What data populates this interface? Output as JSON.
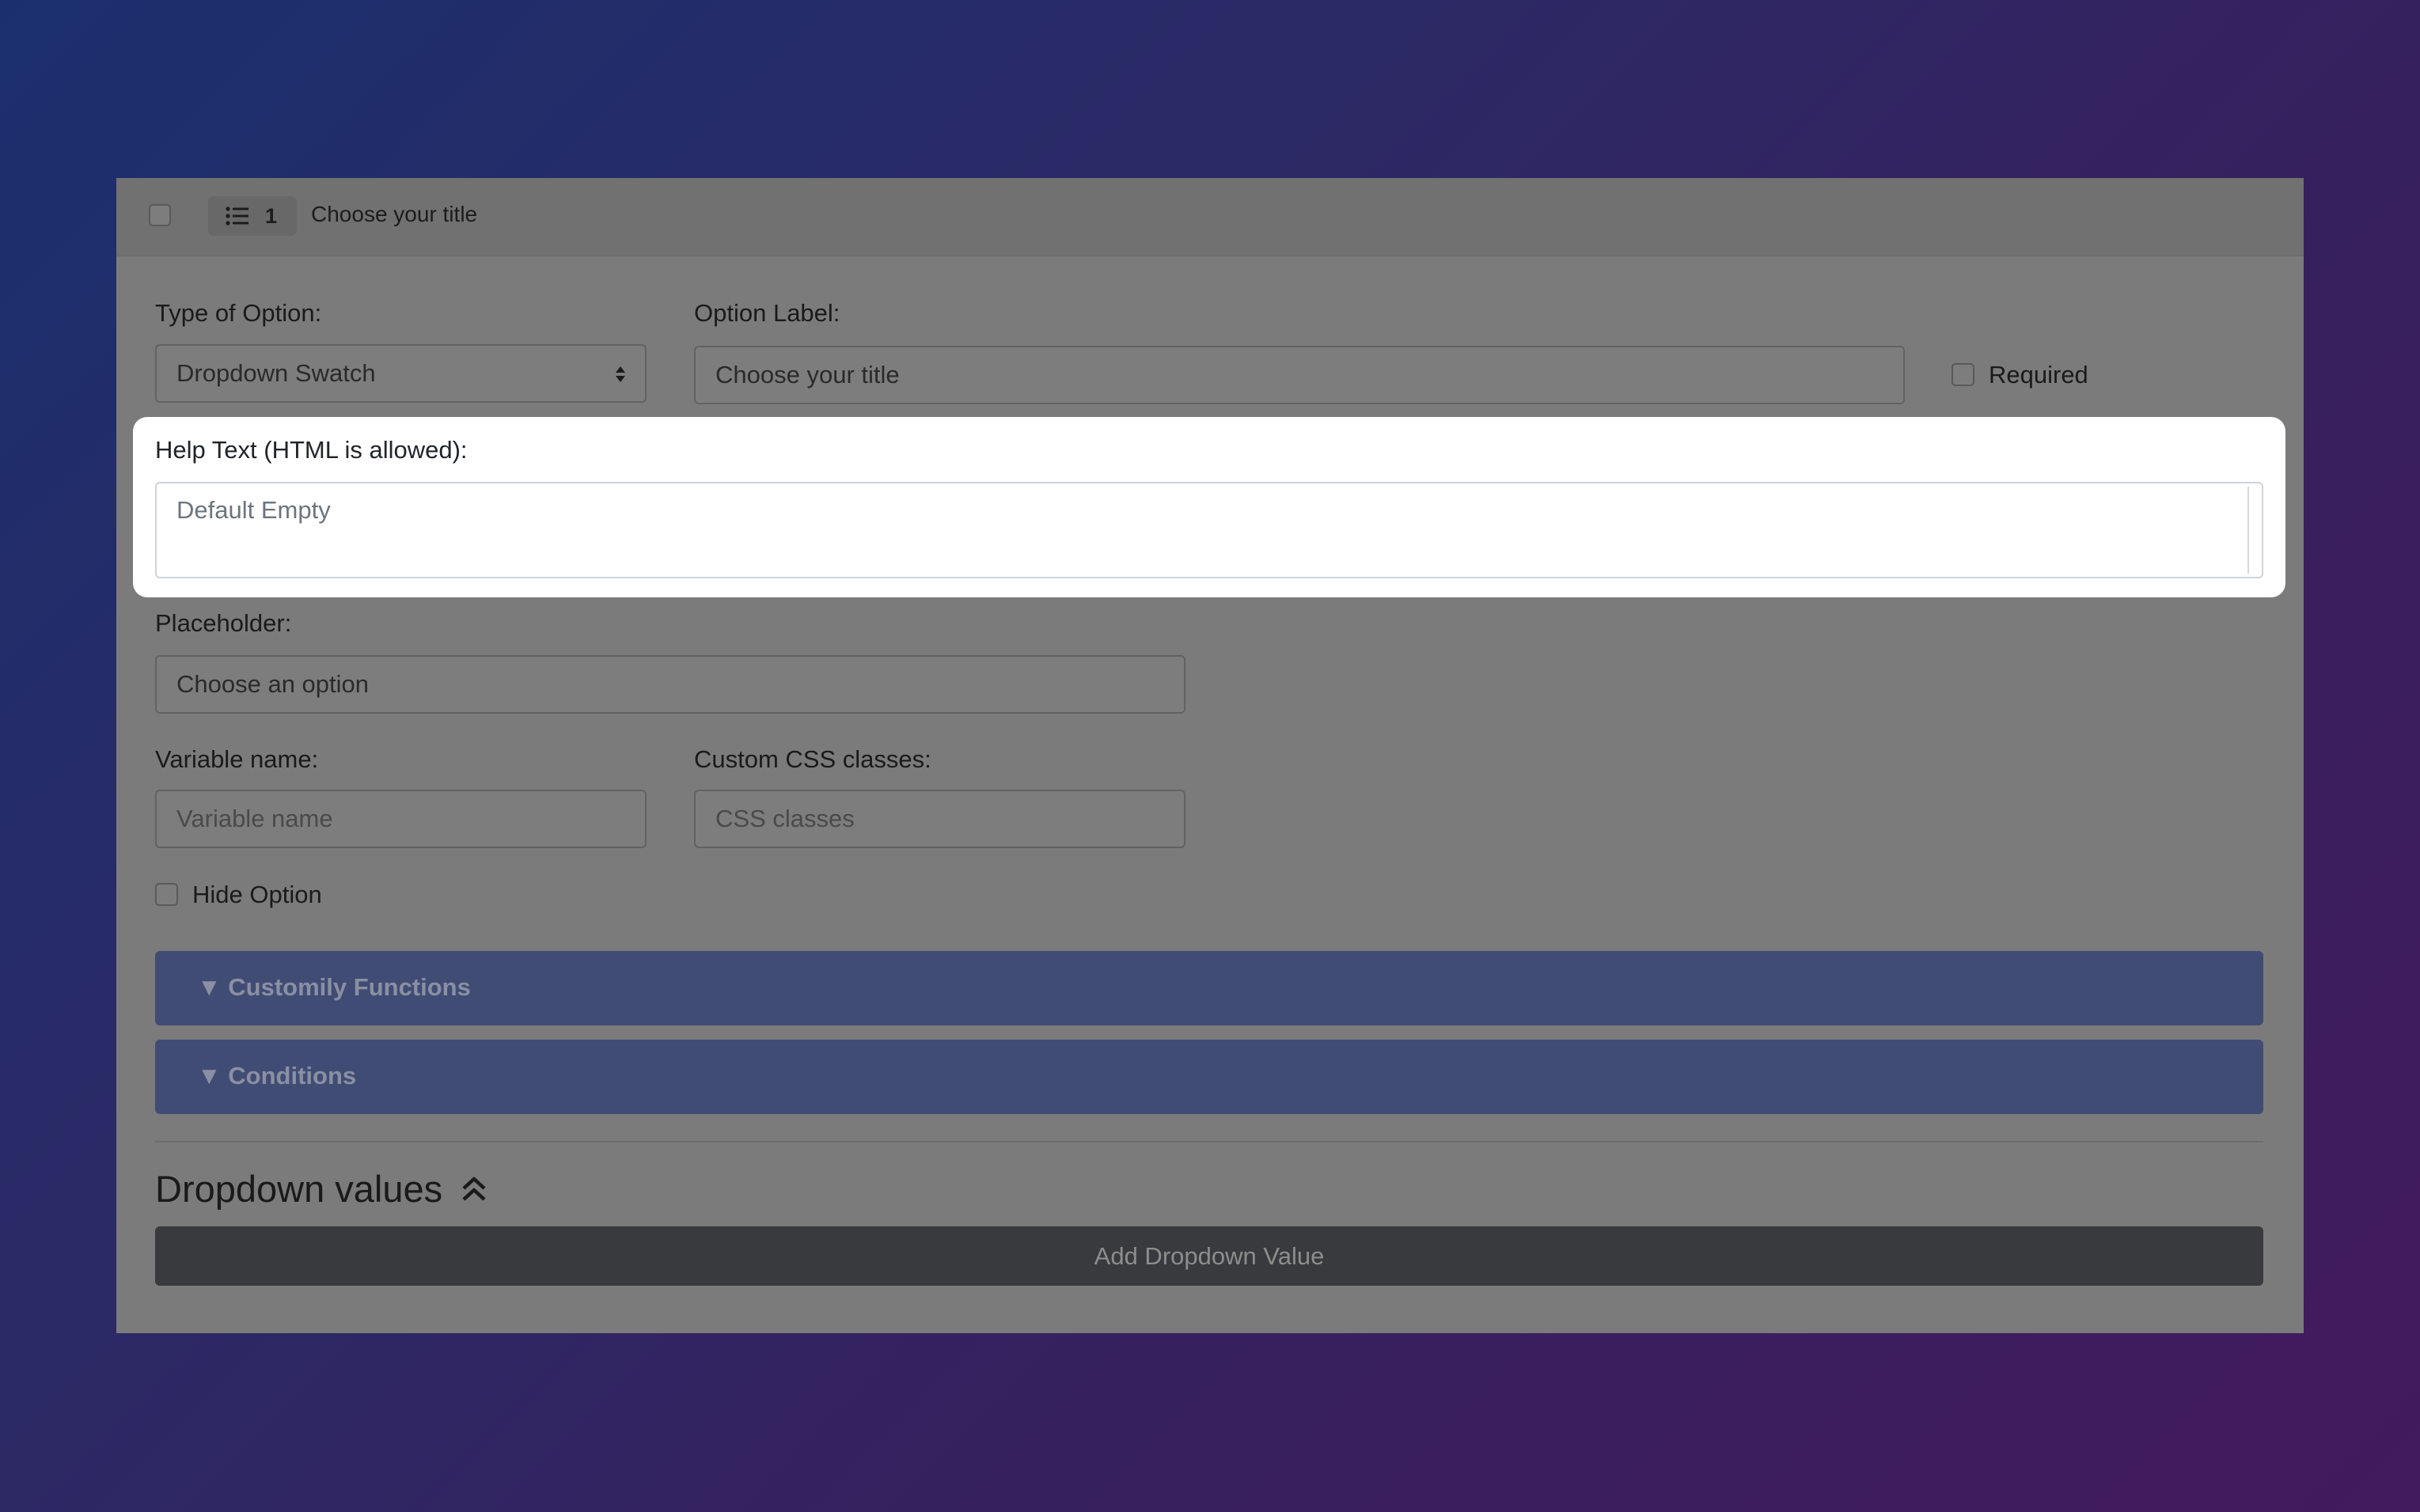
{
  "header": {
    "badge_number": "1",
    "title": "Choose your title"
  },
  "form": {
    "type_label": "Type of Option:",
    "type_value": "Dropdown Swatch",
    "option_label_label": "Option Label:",
    "option_label_value": "Choose your title",
    "required_label": "Required",
    "help_text_label": "Help Text (HTML is allowed):",
    "help_text_placeholder": "Default Empty",
    "placeholder_label": "Placeholder:",
    "placeholder_value": "Choose an option",
    "variable_label": "Variable name:",
    "variable_placeholder": "Variable name",
    "css_label": "Custom CSS classes:",
    "css_placeholder": "CSS classes",
    "hide_option_label": "Hide Option"
  },
  "accordions": [
    {
      "label": "▼ Customily Functions"
    },
    {
      "label": "▼ Conditions"
    }
  ],
  "dropdown_values": {
    "title": "Dropdown values",
    "add_button": "Add Dropdown Value"
  },
  "icons": {
    "list": "list-icon",
    "select_arrows": "sort-arrows-icon",
    "collapse": "double-chevron-up-icon"
  }
}
